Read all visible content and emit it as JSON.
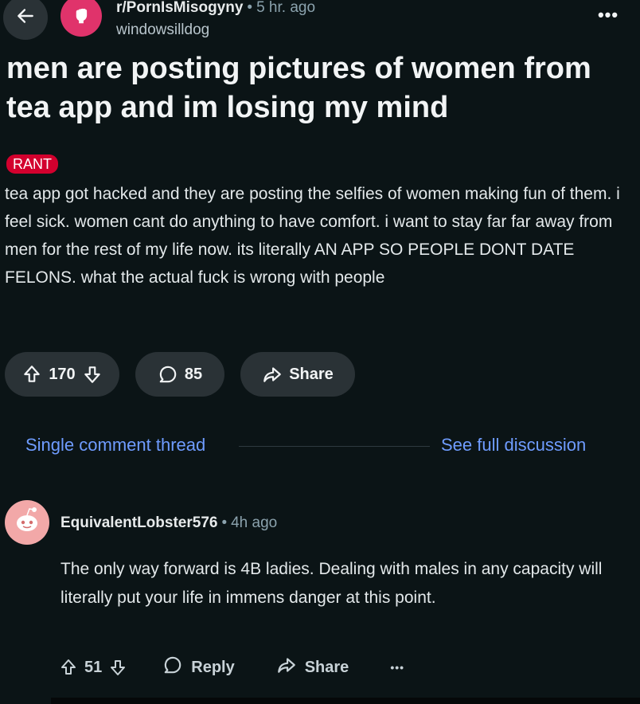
{
  "header": {
    "subreddit": "r/PornIsMisogyny",
    "separator": "•",
    "post_age": "5 hr. ago",
    "author": "windowsilldog",
    "more_label": "•••"
  },
  "post": {
    "title": "men are posting pictures of women from tea app and im losing my mind",
    "flair": "RANT",
    "body": "tea app got hacked and they are posting the selfies of women making fun of them. i feel sick. women cant do anything to have comfort. i want to stay far far away from men for the rest of my life now. its literally AN APP SO PEOPLE DONT DATE FELONS. what the actual fuck is wrong with people",
    "votes": "170",
    "comments": "85",
    "share_label": "Share"
  },
  "thread": {
    "single_label": "Single comment thread",
    "full_label": "See full discussion"
  },
  "comment": {
    "author": "EquivalentLobster576",
    "separator": "•",
    "age": "4h ago",
    "body": "The only way forward is 4B ladies. Dealing with males in any capacity will literally put your life in immens danger at this point.",
    "votes": "51",
    "reply_label": "Reply",
    "share_label": "Share",
    "more_label": "•••"
  },
  "colors": {
    "background": "#0b1416",
    "pill": "#2a3236",
    "link": "#6f9cff",
    "flair": "#d3002e",
    "subreddit_icon": "#e0336b"
  }
}
